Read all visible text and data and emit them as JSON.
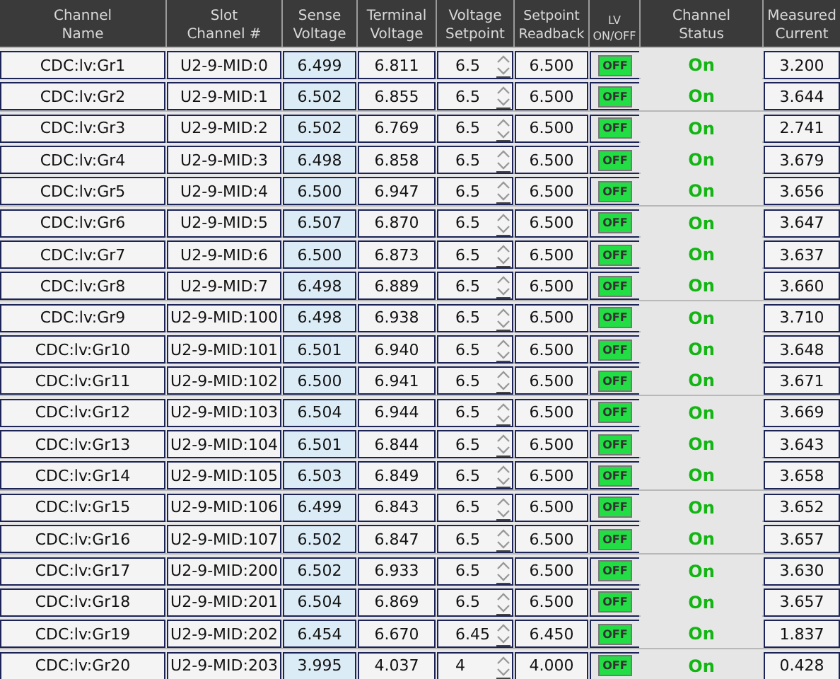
{
  "columns": [
    [
      "Channel",
      "Name"
    ],
    [
      "Slot",
      "Channel #"
    ],
    [
      "Sense",
      "Voltage"
    ],
    [
      "Terminal",
      "Voltage"
    ],
    [
      "Voltage",
      "Setpoint"
    ],
    [
      "Setpoint",
      "Readback"
    ],
    [
      "LV",
      "ON/OFF"
    ],
    [
      "Channel",
      "Status"
    ],
    [
      "Measured",
      "Current"
    ]
  ],
  "rows": [
    {
      "name": "CDC:lv:Gr1",
      "slot": "U2-9-MID:0",
      "sense": "6.499",
      "terminal": "6.811",
      "setpoint": "6.5",
      "readback": "6.500",
      "lv_button": "OFF",
      "lv_active": true,
      "status": "On",
      "status_ok": true,
      "current": "3.200"
    },
    {
      "name": "CDC:lv:Gr2",
      "slot": "U2-9-MID:1",
      "sense": "6.502",
      "terminal": "6.855",
      "setpoint": "6.5",
      "readback": "6.500",
      "lv_button": "OFF",
      "lv_active": true,
      "status": "On",
      "status_ok": true,
      "current": "3.644"
    },
    {
      "name": "CDC:lv:Gr3",
      "slot": "U2-9-MID:2",
      "sense": "6.502",
      "terminal": "6.769",
      "setpoint": "6.5",
      "readback": "6.500",
      "lv_button": "OFF",
      "lv_active": true,
      "status": "On",
      "status_ok": true,
      "current": "2.741"
    },
    {
      "name": "CDC:lv:Gr4",
      "slot": "U2-9-MID:3",
      "sense": "6.498",
      "terminal": "6.858",
      "setpoint": "6.5",
      "readback": "6.500",
      "lv_button": "OFF",
      "lv_active": true,
      "status": "On",
      "status_ok": true,
      "current": "3.679"
    },
    {
      "name": "CDC:lv:Gr5",
      "slot": "U2-9-MID:4",
      "sense": "6.500",
      "terminal": "6.947",
      "setpoint": "6.5",
      "readback": "6.500",
      "lv_button": "OFF",
      "lv_active": true,
      "status": "On",
      "status_ok": true,
      "current": "3.656"
    },
    {
      "name": "CDC:lv:Gr6",
      "slot": "U2-9-MID:5",
      "sense": "6.507",
      "terminal": "6.870",
      "setpoint": "6.5",
      "readback": "6.500",
      "lv_button": "OFF",
      "lv_active": true,
      "status": "On",
      "status_ok": true,
      "current": "3.647"
    },
    {
      "name": "CDC:lv:Gr7",
      "slot": "U2-9-MID:6",
      "sense": "6.500",
      "terminal": "6.873",
      "setpoint": "6.5",
      "readback": "6.500",
      "lv_button": "OFF",
      "lv_active": true,
      "status": "On",
      "status_ok": true,
      "current": "3.637"
    },
    {
      "name": "CDC:lv:Gr8",
      "slot": "U2-9-MID:7",
      "sense": "6.498",
      "terminal": "6.889",
      "setpoint": "6.5",
      "readback": "6.500",
      "lv_button": "OFF",
      "lv_active": true,
      "status": "On",
      "status_ok": true,
      "current": "3.660"
    },
    {
      "name": "CDC:lv:Gr9",
      "slot": "U2-9-MID:100",
      "sense": "6.498",
      "terminal": "6.938",
      "setpoint": "6.5",
      "readback": "6.500",
      "lv_button": "OFF",
      "lv_active": true,
      "status": "On",
      "status_ok": true,
      "current": "3.710"
    },
    {
      "name": "CDC:lv:Gr10",
      "slot": "U2-9-MID:101",
      "sense": "6.501",
      "terminal": "6.940",
      "setpoint": "6.5",
      "readback": "6.500",
      "lv_button": "OFF",
      "lv_active": true,
      "status": "On",
      "status_ok": true,
      "current": "3.648"
    },
    {
      "name": "CDC:lv:Gr11",
      "slot": "U2-9-MID:102",
      "sense": "6.500",
      "terminal": "6.941",
      "setpoint": "6.5",
      "readback": "6.500",
      "lv_button": "OFF",
      "lv_active": true,
      "status": "On",
      "status_ok": true,
      "current": "3.671"
    },
    {
      "name": "CDC:lv:Gr12",
      "slot": "U2-9-MID:103",
      "sense": "6.504",
      "terminal": "6.944",
      "setpoint": "6.5",
      "readback": "6.500",
      "lv_button": "OFF",
      "lv_active": true,
      "status": "On",
      "status_ok": true,
      "current": "3.669"
    },
    {
      "name": "CDC:lv:Gr13",
      "slot": "U2-9-MID:104",
      "sense": "6.501",
      "terminal": "6.844",
      "setpoint": "6.5",
      "readback": "6.500",
      "lv_button": "OFF",
      "lv_active": true,
      "status": "On",
      "status_ok": true,
      "current": "3.643"
    },
    {
      "name": "CDC:lv:Gr14",
      "slot": "U2-9-MID:105",
      "sense": "6.503",
      "terminal": "6.849",
      "setpoint": "6.5",
      "readback": "6.500",
      "lv_button": "OFF",
      "lv_active": true,
      "status": "On",
      "status_ok": true,
      "current": "3.658"
    },
    {
      "name": "CDC:lv:Gr15",
      "slot": "U2-9-MID:106",
      "sense": "6.499",
      "terminal": "6.843",
      "setpoint": "6.5",
      "readback": "6.500",
      "lv_button": "OFF",
      "lv_active": true,
      "status": "On",
      "status_ok": true,
      "current": "3.652"
    },
    {
      "name": "CDC:lv:Gr16",
      "slot": "U2-9-MID:107",
      "sense": "6.502",
      "terminal": "6.847",
      "setpoint": "6.5",
      "readback": "6.500",
      "lv_button": "OFF",
      "lv_active": true,
      "status": "On",
      "status_ok": true,
      "current": "3.657"
    },
    {
      "name": "CDC:lv:Gr17",
      "slot": "U2-9-MID:200",
      "sense": "6.502",
      "terminal": "6.933",
      "setpoint": "6.5",
      "readback": "6.500",
      "lv_button": "OFF",
      "lv_active": true,
      "status": "On",
      "status_ok": true,
      "current": "3.630"
    },
    {
      "name": "CDC:lv:Gr18",
      "slot": "U2-9-MID:201",
      "sense": "6.504",
      "terminal": "6.869",
      "setpoint": "6.5",
      "readback": "6.500",
      "lv_button": "OFF",
      "lv_active": true,
      "status": "On",
      "status_ok": true,
      "current": "3.657"
    },
    {
      "name": "CDC:lv:Gr19",
      "slot": "U2-9-MID:202",
      "sense": "6.454",
      "terminal": "6.670",
      "setpoint": "6.45",
      "readback": "6.450",
      "lv_button": "OFF",
      "lv_active": true,
      "status": "On",
      "status_ok": true,
      "current": "1.837"
    },
    {
      "name": "CDC:lv:Gr20",
      "slot": "U2-9-MID:203",
      "sense": "3.995",
      "terminal": "4.037",
      "setpoint": "4",
      "readback": "4.000",
      "lv_button": "OFF",
      "lv_active": true,
      "status": "On",
      "status_ok": true,
      "current": "0.428"
    }
  ]
}
